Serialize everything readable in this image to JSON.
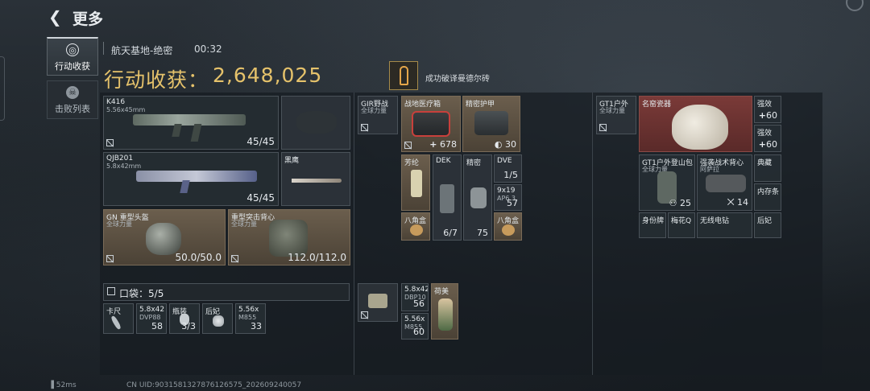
{
  "header": {
    "back_icon": "chevron-left-icon",
    "title": "更多"
  },
  "tabs": [
    {
      "label": "行动收获",
      "active": true,
      "icon": "target-icon"
    },
    {
      "label": "击败列表",
      "active": false,
      "icon": "skull-icon"
    }
  ],
  "match": {
    "map": "航天基地-绝密",
    "duration": "00:32"
  },
  "gain": {
    "label": "行动收获：",
    "value": "2,648,025"
  },
  "achievement": {
    "text": "成功破译曼德尔砖",
    "icon": "key-icon"
  },
  "equipment": {
    "primary1": {
      "name": "K416",
      "sub": "5.56x45mm",
      "ammo": "45/45"
    },
    "pistol": {
      "name": ""
    },
    "primary2": {
      "name": "QJB201",
      "sub": "5.8x42mm",
      "ammo": "45/45"
    },
    "melee": {
      "name": "黑鹰"
    },
    "helmet": {
      "name": "GN 重型头盔",
      "sub": "全球力量",
      "durability": "50.0/50.0"
    },
    "armor": {
      "name": "重型突击背心",
      "sub": "全球力量",
      "durability": "112.0/112.0"
    }
  },
  "pocket": {
    "label": "口袋：",
    "count": "5/5",
    "items": [
      {
        "name": "卡尺",
        "count": ""
      },
      {
        "name": "5.8x42",
        "sub": "DVP88",
        "count": "58"
      },
      {
        "name": "瓶装",
        "count": "3/3"
      },
      {
        "name": "后妃",
        "count": ""
      },
      {
        "name": "5.56x",
        "sub": "M855",
        "count": "33"
      }
    ]
  },
  "rig": {
    "header": {
      "name": "GIR野战",
      "sub": "全球力量"
    },
    "items": [
      {
        "name": "战地医疗箱",
        "count": "678"
      },
      {
        "name": "精密护甲",
        "count": "30"
      },
      {
        "name": "芳纶",
        "count": ""
      },
      {
        "name": "DEK",
        "count": "6/7"
      },
      {
        "name": "精密",
        "count": "75"
      },
      {
        "name": "DVE",
        "count": "1/5"
      },
      {
        "name": "9x19",
        "sub": "AP6.3",
        "count": "57"
      },
      {
        "name": "八角盒",
        "count": ""
      },
      {
        "name": "八角盒",
        "count": ""
      }
    ],
    "bottom": [
      {
        "name": "5.8x42",
        "sub": "DBP10",
        "count": "56"
      },
      {
        "name": "荷美",
        "count": ""
      },
      {
        "name": "5.56x",
        "sub": "M855",
        "count": "60"
      }
    ]
  },
  "backpack": {
    "header": {
      "name": "GT1户外",
      "sub": "全球力量"
    },
    "items": [
      {
        "name": "名窑瓷器",
        "count": ""
      },
      {
        "name": "强效",
        "count": "60"
      },
      {
        "name": "强效",
        "count": "60"
      },
      {
        "name": "GT1户外登山包",
        "sub": "全球力量",
        "count": "25"
      },
      {
        "name": "强袭战术背心",
        "sub": "阿萨拉",
        "count": "14"
      },
      {
        "name": "典藏",
        "count": ""
      },
      {
        "name": "内存条",
        "count": ""
      },
      {
        "name": "身份牌",
        "count": ""
      },
      {
        "name": "梅花Q",
        "count": ""
      },
      {
        "name": "无线电钻",
        "count": ""
      },
      {
        "name": "后妃",
        "count": ""
      }
    ]
  },
  "footer": {
    "ping": "52ms",
    "uid": "CN UID:90315813278761265​75_202609240057"
  },
  "colors": {
    "gold": "#e5c26b",
    "panel": "#1c2227",
    "tan": "#6b5e4d",
    "red": "#7a3a38"
  }
}
